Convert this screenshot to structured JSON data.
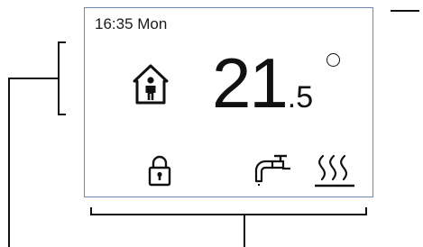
{
  "status_bar": {
    "clock": "16:35 Mon"
  },
  "main": {
    "mode_icon": "home-occupied-icon",
    "temperature": {
      "integer": "21",
      "decimal": ".5",
      "unit_icon": "degree-icon"
    }
  },
  "footer_icons": {
    "lock": "lock-icon",
    "hot_water": "tap-icon",
    "heating": "heating-icon"
  },
  "colors": {
    "screen_border": "#6f86b8",
    "foreground": "#111111",
    "background": "#ffffff"
  }
}
